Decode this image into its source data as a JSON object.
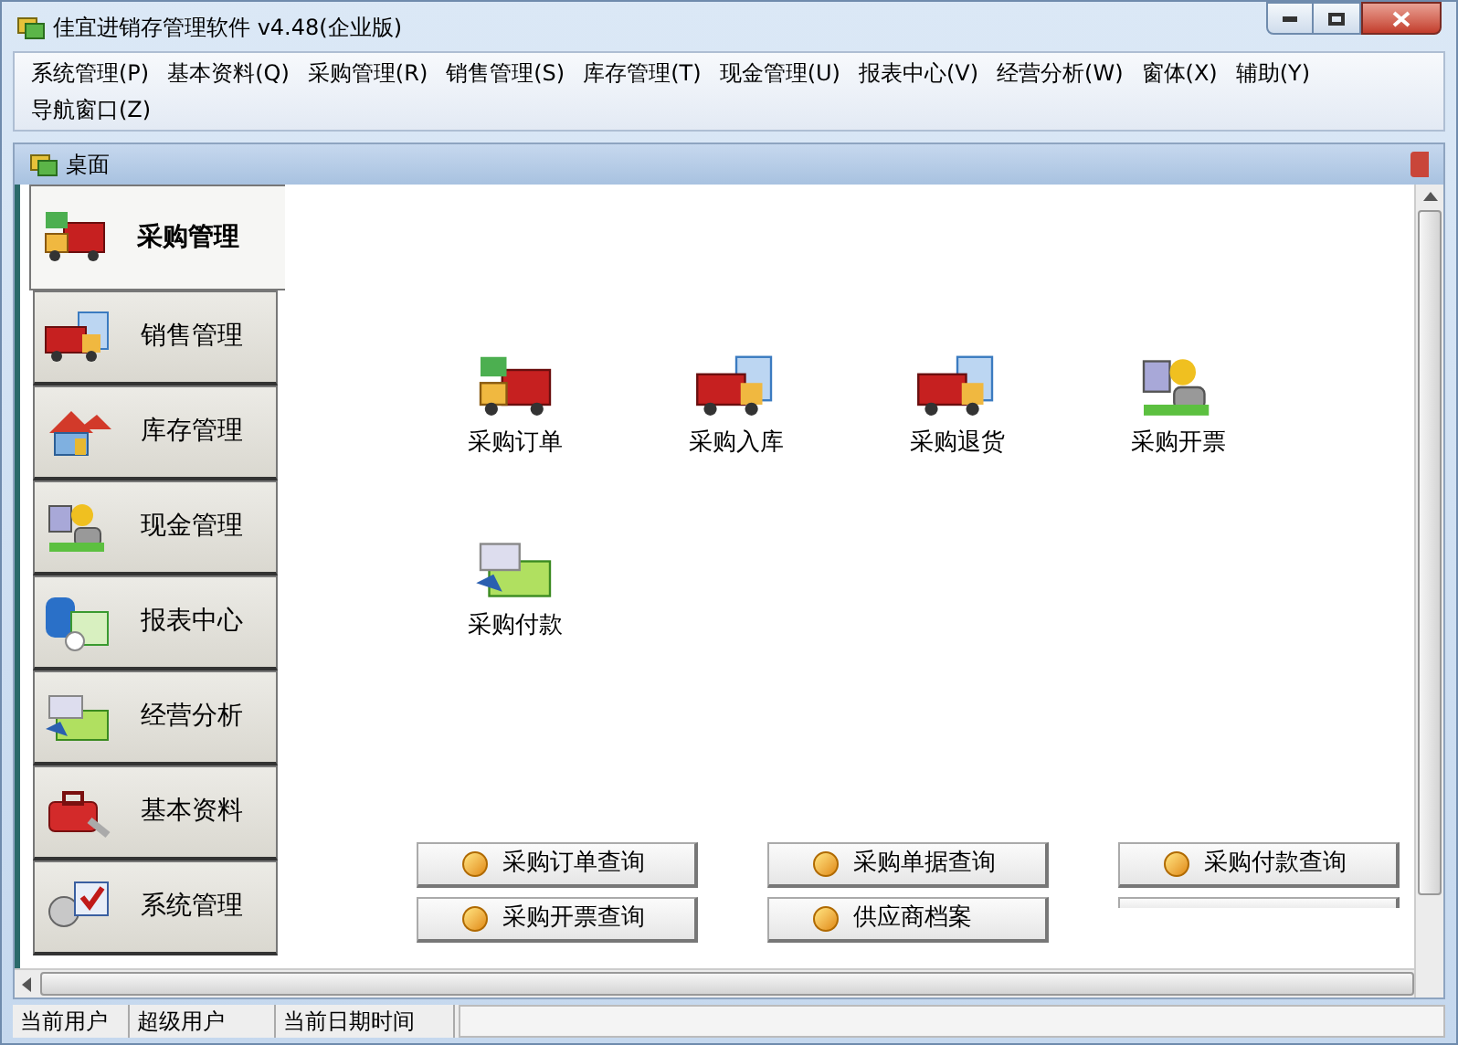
{
  "window": {
    "title": "佳宜进销存管理软件 v4.48(企业版)"
  },
  "menu": [
    "系统管理(P)",
    "基本资料(Q)",
    "采购管理(R)",
    "销售管理(S)",
    "库存管理(T)",
    "现金管理(U)",
    "报表中心(V)",
    "经营分析(W)",
    "窗体(X)",
    "辅助(Y)",
    "导航窗口(Z)"
  ],
  "desktop": {
    "title": "桌面"
  },
  "sidebar": {
    "items": [
      {
        "label": "采购管理",
        "selected": true
      },
      {
        "label": "销售管理",
        "selected": false
      },
      {
        "label": "库存管理",
        "selected": false
      },
      {
        "label": "现金管理",
        "selected": false
      },
      {
        "label": "报表中心",
        "selected": false
      },
      {
        "label": "经营分析",
        "selected": false
      },
      {
        "label": "基本资料",
        "selected": false
      },
      {
        "label": "系统管理",
        "selected": false
      }
    ]
  },
  "functions": [
    "采购订单",
    "采购入库",
    "采购退货",
    "采购开票",
    "采购付款"
  ],
  "quick_buttons": [
    "采购订单查询",
    "采购单据查询",
    "采购付款查询",
    "采购开票查询",
    "供应商档案"
  ],
  "status_bar": [
    "当前用户",
    "超级用户",
    "当前日期时间"
  ]
}
